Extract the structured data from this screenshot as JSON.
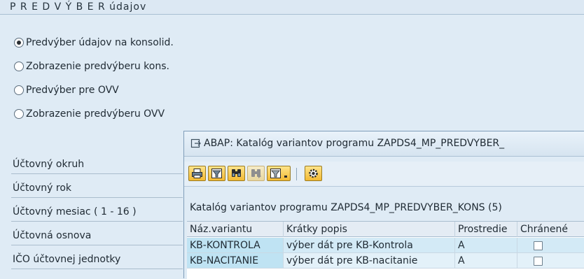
{
  "screen": {
    "title": "P R E D V Ý B E R  údajov",
    "radios": [
      {
        "label": "Predvýber údajov na konsolid.",
        "checked": true
      },
      {
        "label": "Zobrazenie predvýberu kons.",
        "checked": false
      },
      {
        "label": "Predvýber pre OVV",
        "checked": false
      },
      {
        "label": "Zobrazenie predvýberu OVV",
        "checked": false
      }
    ],
    "fields": [
      {
        "label": "Účtovný okruh"
      },
      {
        "label": "Účtovný rok"
      },
      {
        "label": "Účtovný mesiac ( 1 - 16 )"
      },
      {
        "label": "Účtovná osnova"
      },
      {
        "label": "IČO účtovnej jednotky"
      }
    ]
  },
  "dialog": {
    "title": "ABAP: Katalóg variantov programu ZAPDS4_MP_PREDVYBER_",
    "toolbar_icons": [
      "print-icon",
      "filter-icon",
      "find-icon",
      "find-next-icon",
      "set-filter-icon",
      "settings-icon"
    ],
    "caption": "Katalóg variantov programu ZAPDS4_MP_PREDVYBER_KONS (5)",
    "columns": [
      "Náz.variantu",
      "Krátky popis",
      "Prostredie",
      "Chránené"
    ],
    "rows": [
      {
        "name": "KB-KONTROLA",
        "desc": "výber dát pre KB-Kontrola",
        "env": "A",
        "protected": false
      },
      {
        "name": "KB-NACITANIE",
        "desc": "výber dát pre KB-nacitanie",
        "env": "A",
        "protected": false
      }
    ]
  },
  "colors": {
    "background": "#dfebf5",
    "toolbar_button": "#f2b933",
    "selected_row": "#d3eaf6",
    "key_cell": "#bfe3f3"
  }
}
